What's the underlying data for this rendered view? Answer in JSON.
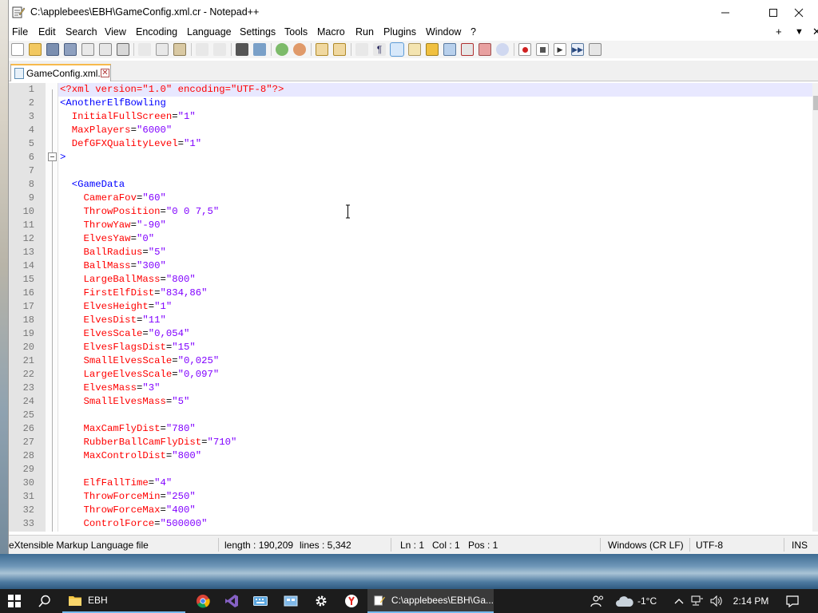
{
  "window": {
    "title": "C:\\applebees\\EBH\\GameConfig.xml.cr - Notepad++"
  },
  "menu": {
    "items": [
      "File",
      "Edit",
      "Search",
      "View",
      "Encoding",
      "Language",
      "Settings",
      "Tools",
      "Macro",
      "Run",
      "Plugins",
      "Window",
      "?"
    ],
    "right": [
      "+",
      "▼",
      "✕"
    ]
  },
  "tab": {
    "label": "GameConfig.xml.cr"
  },
  "editor": {
    "lines": [
      {
        "n": "1",
        "kind": "pi",
        "text": "<?xml version=\"1.0\" encoding=\"UTF-8\"?>"
      },
      {
        "n": "2",
        "kind": "tag",
        "indent": "",
        "text": "<AnotherElfBowling"
      },
      {
        "n": "3",
        "kind": "attr",
        "indent": "  ",
        "name": "InitialFullScreen",
        "value": "\"1\""
      },
      {
        "n": "4",
        "kind": "attr",
        "indent": "  ",
        "name": "MaxPlayers",
        "value": "\"6000\""
      },
      {
        "n": "5",
        "kind": "attr",
        "indent": "  ",
        "name": "DefGFXQualityLevel",
        "value": "\"1\""
      },
      {
        "n": "6",
        "kind": "tag",
        "indent": "",
        "text": ">"
      },
      {
        "n": "7",
        "kind": "blank"
      },
      {
        "n": "8",
        "kind": "tag",
        "indent": "  ",
        "text": "<GameData"
      },
      {
        "n": "9",
        "kind": "attr",
        "indent": "    ",
        "name": "CameraFov",
        "value": "\"60\""
      },
      {
        "n": "10",
        "kind": "attr",
        "indent": "    ",
        "name": "ThrowPosition",
        "value": "\"0 0 7,5\""
      },
      {
        "n": "11",
        "kind": "attr",
        "indent": "    ",
        "name": "ThrowYaw",
        "value": "\"-90\""
      },
      {
        "n": "12",
        "kind": "attr",
        "indent": "    ",
        "name": "ElvesYaw",
        "value": "\"0\""
      },
      {
        "n": "13",
        "kind": "attr",
        "indent": "    ",
        "name": "BallRadius",
        "value": "\"5\""
      },
      {
        "n": "14",
        "kind": "attr",
        "indent": "    ",
        "name": "BallMass",
        "value": "\"300\""
      },
      {
        "n": "15",
        "kind": "attr",
        "indent": "    ",
        "name": "LargeBallMass",
        "value": "\"800\""
      },
      {
        "n": "16",
        "kind": "attr",
        "indent": "    ",
        "name": "FirstElfDist",
        "value": "\"834,86\""
      },
      {
        "n": "17",
        "kind": "attr",
        "indent": "    ",
        "name": "ElvesHeight",
        "value": "\"1\""
      },
      {
        "n": "18",
        "kind": "attr",
        "indent": "    ",
        "name": "ElvesDist",
        "value": "\"11\""
      },
      {
        "n": "19",
        "kind": "attr",
        "indent": "    ",
        "name": "ElvesScale",
        "value": "\"0,054\""
      },
      {
        "n": "20",
        "kind": "attr",
        "indent": "    ",
        "name": "ElvesFlagsDist",
        "value": "\"15\""
      },
      {
        "n": "21",
        "kind": "attr",
        "indent": "    ",
        "name": "SmallElvesScale",
        "value": "\"0,025\""
      },
      {
        "n": "22",
        "kind": "attr",
        "indent": "    ",
        "name": "LargeElvesScale",
        "value": "\"0,097\""
      },
      {
        "n": "23",
        "kind": "attr",
        "indent": "    ",
        "name": "ElvesMass",
        "value": "\"3\""
      },
      {
        "n": "24",
        "kind": "attr",
        "indent": "    ",
        "name": "SmallElvesMass",
        "value": "\"5\""
      },
      {
        "n": "25",
        "kind": "blank"
      },
      {
        "n": "26",
        "kind": "attr",
        "indent": "    ",
        "name": "MaxCamFlyDist",
        "value": "\"780\""
      },
      {
        "n": "27",
        "kind": "attr",
        "indent": "    ",
        "name": "RubberBallCamFlyDist",
        "value": "\"710\""
      },
      {
        "n": "28",
        "kind": "attr",
        "indent": "    ",
        "name": "MaxControlDist",
        "value": "\"800\""
      },
      {
        "n": "29",
        "kind": "blank"
      },
      {
        "n": "30",
        "kind": "attr",
        "indent": "    ",
        "name": "ElfFallTime",
        "value": "\"4\""
      },
      {
        "n": "31",
        "kind": "attr",
        "indent": "    ",
        "name": "ThrowForceMin",
        "value": "\"250\""
      },
      {
        "n": "32",
        "kind": "attr",
        "indent": "    ",
        "name": "ThrowForceMax",
        "value": "\"400\""
      },
      {
        "n": "33",
        "kind": "attr",
        "indent": "    ",
        "name": "ControlForce",
        "value": "\"500000\""
      }
    ]
  },
  "status": {
    "filetype": "eXtensible Markup Language file",
    "length": "length : 190,209",
    "lines": "lines : 5,342",
    "ln": "Ln : 1",
    "col": "Col : 1",
    "pos": "Pos : 1",
    "eol": "Windows (CR LF)",
    "encoding": "UTF-8",
    "mode": "INS"
  },
  "taskbar": {
    "folder_label": "EBH",
    "npp_label": "C:\\applebees\\EBH\\Ga...",
    "temperature": "-1°C",
    "time": "2:14 PM"
  },
  "colors": {
    "tag": "#0000ff",
    "attribute": "#ff0000",
    "value": "#8000ff",
    "current_line": "#e8e8ff",
    "tab_accent": "#f7b94c"
  }
}
